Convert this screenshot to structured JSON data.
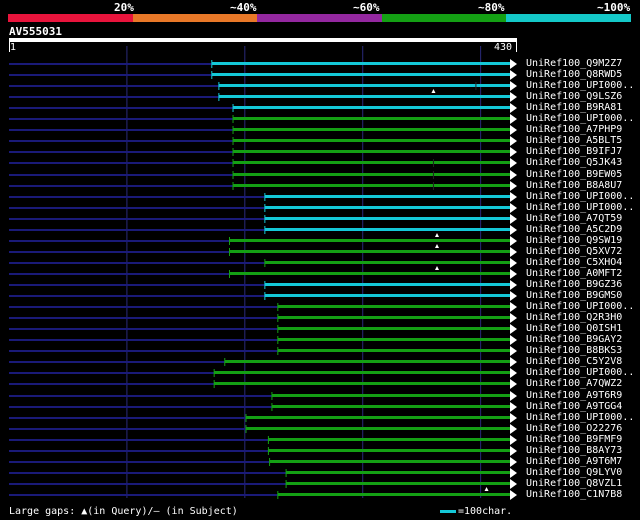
{
  "legend": {
    "segments": [
      {
        "label": "20%",
        "color": "#e8143c"
      },
      {
        "label": "~40%",
        "color": "#e87828"
      },
      {
        "label": "~60%",
        "color": "#9428a0"
      },
      {
        "label": "~80%",
        "color": "#14a014"
      },
      {
        "label": "~100%",
        "color": "#14c8c8"
      }
    ]
  },
  "query": {
    "name": "AV555031",
    "start_label": "1",
    "end_label": "430",
    "length": 430
  },
  "colors": {
    "track": "#1a1a78",
    "cyan": "#14c8d8",
    "green": "#14a014",
    "grid": "#2a2a7a",
    "marker": "#ffffff"
  },
  "chart_data": {
    "type": "alignment",
    "query_length": 430,
    "hits": [
      {
        "name": "UniRef100_Q9M2Z7",
        "start": 172,
        "end": 430,
        "identity": "~100%",
        "gap_markers": []
      },
      {
        "name": "UniRef100_Q8RWD5",
        "start": 172,
        "end": 430,
        "identity": "~100%",
        "gap_markers": []
      },
      {
        "name": "UniRef100_UPI000..",
        "start": 178,
        "end": 430,
        "identity": "~100%",
        "gap_markers": [
          {
            "pos": 396,
            "type": "subject"
          }
        ]
      },
      {
        "name": "UniRef100_Q9LSZ6",
        "start": 178,
        "end": 430,
        "identity": "~100%",
        "gap_markers": [
          {
            "pos": 360,
            "type": "query"
          }
        ]
      },
      {
        "name": "UniRef100_B9RA81",
        "start": 190,
        "end": 430,
        "identity": "~100%",
        "gap_markers": []
      },
      {
        "name": "UniRef100_UPI000..",
        "start": 190,
        "end": 430,
        "identity": "~80%",
        "gap_markers": []
      },
      {
        "name": "UniRef100_A7PHP9",
        "start": 190,
        "end": 430,
        "identity": "~80%",
        "gap_markers": []
      },
      {
        "name": "UniRef100_A5BLT5",
        "start": 190,
        "end": 430,
        "identity": "~80%",
        "gap_markers": []
      },
      {
        "name": "UniRef100_B9IFJ7",
        "start": 190,
        "end": 430,
        "identity": "~80%",
        "gap_markers": []
      },
      {
        "name": "UniRef100_Q5JK43",
        "start": 190,
        "end": 430,
        "identity": "~80%",
        "gap_markers": [
          {
            "pos": 360,
            "type": "subject"
          }
        ]
      },
      {
        "name": "UniRef100_B9EW05",
        "start": 190,
        "end": 430,
        "identity": "~80%",
        "gap_markers": [
          {
            "pos": 360,
            "type": "subject"
          }
        ]
      },
      {
        "name": "UniRef100_B8A8U7",
        "start": 190,
        "end": 430,
        "identity": "~80%",
        "gap_markers": [
          {
            "pos": 360,
            "type": "subject"
          }
        ]
      },
      {
        "name": "UniRef100_UPI000..",
        "start": 217,
        "end": 430,
        "identity": "~100%",
        "gap_markers": []
      },
      {
        "name": "UniRef100_UPI000..",
        "start": 217,
        "end": 430,
        "identity": "~100%",
        "gap_markers": []
      },
      {
        "name": "UniRef100_A7QT59",
        "start": 217,
        "end": 430,
        "identity": "~100%",
        "gap_markers": []
      },
      {
        "name": "UniRef100_A5C2D9",
        "start": 217,
        "end": 430,
        "identity": "~100%",
        "gap_markers": []
      },
      {
        "name": "UniRef100_Q9SW19",
        "start": 187,
        "end": 430,
        "identity": "~80%",
        "gap_markers": [
          {
            "pos": 363,
            "type": "query"
          }
        ]
      },
      {
        "name": "UniRef100_Q5XV72",
        "start": 187,
        "end": 430,
        "identity": "~80%",
        "gap_markers": [
          {
            "pos": 363,
            "type": "query"
          }
        ]
      },
      {
        "name": "UniRef100_C5XHO4",
        "start": 217,
        "end": 430,
        "identity": "~80%",
        "gap_markers": []
      },
      {
        "name": "UniRef100_A0MFT2",
        "start": 187,
        "end": 430,
        "identity": "~80%",
        "gap_markers": [
          {
            "pos": 363,
            "type": "query"
          }
        ]
      },
      {
        "name": "UniRef100_B9GZ36",
        "start": 217,
        "end": 430,
        "identity": "~100%",
        "gap_markers": []
      },
      {
        "name": "UniRef100_B9GMS0",
        "start": 217,
        "end": 430,
        "identity": "~100%",
        "gap_markers": []
      },
      {
        "name": "UniRef100_UPI000..",
        "start": 228,
        "end": 430,
        "identity": "~80%",
        "gap_markers": []
      },
      {
        "name": "UniRef100_Q2R3H0",
        "start": 228,
        "end": 430,
        "identity": "~80%",
        "gap_markers": []
      },
      {
        "name": "UniRef100_Q0ISH1",
        "start": 228,
        "end": 430,
        "identity": "~80%",
        "gap_markers": []
      },
      {
        "name": "UniRef100_B9GAY2",
        "start": 228,
        "end": 430,
        "identity": "~80%",
        "gap_markers": []
      },
      {
        "name": "UniRef100_B8BKS3",
        "start": 228,
        "end": 430,
        "identity": "~80%",
        "gap_markers": []
      },
      {
        "name": "UniRef100_C5Y2V8",
        "start": 183,
        "end": 430,
        "identity": "~80%",
        "gap_markers": []
      },
      {
        "name": "UniRef100_UPI000..",
        "start": 174,
        "end": 430,
        "identity": "~80%",
        "gap_markers": []
      },
      {
        "name": "UniRef100_A7QWZ2",
        "start": 174,
        "end": 430,
        "identity": "~80%",
        "gap_markers": []
      },
      {
        "name": "UniRef100_A9T6R9",
        "start": 223,
        "end": 430,
        "identity": "~80%",
        "gap_markers": []
      },
      {
        "name": "UniRef100_A9TGG4",
        "start": 223,
        "end": 430,
        "identity": "~80%",
        "gap_markers": []
      },
      {
        "name": "UniRef100_UPI000..",
        "start": 201,
        "end": 430,
        "identity": "~80%",
        "gap_markers": []
      },
      {
        "name": "UniRef100_O22276",
        "start": 201,
        "end": 430,
        "identity": "~80%",
        "gap_markers": []
      },
      {
        "name": "UniRef100_B9FMF9",
        "start": 220,
        "end": 430,
        "identity": "~80%",
        "gap_markers": []
      },
      {
        "name": "UniRef100_B8AY73",
        "start": 220,
        "end": 430,
        "identity": "~80%",
        "gap_markers": []
      },
      {
        "name": "UniRef100_A9T6M7",
        "start": 221,
        "end": 430,
        "identity": "~80%",
        "gap_markers": []
      },
      {
        "name": "UniRef100_Q9LYV0",
        "start": 235,
        "end": 430,
        "identity": "~80%",
        "gap_markers": []
      },
      {
        "name": "UniRef100_Q8VZL1",
        "start": 235,
        "end": 430,
        "identity": "~80%",
        "gap_markers": []
      },
      {
        "name": "UniRef100_C1N7B8",
        "start": 228,
        "end": 430,
        "identity": "~80%",
        "gap_markers": [
          {
            "pos": 405,
            "type": "query"
          }
        ]
      }
    ]
  },
  "footer": {
    "gaps_label": "Large gaps: ▲(in Query)/– (in Subject)",
    "scale_label": "=100char."
  }
}
